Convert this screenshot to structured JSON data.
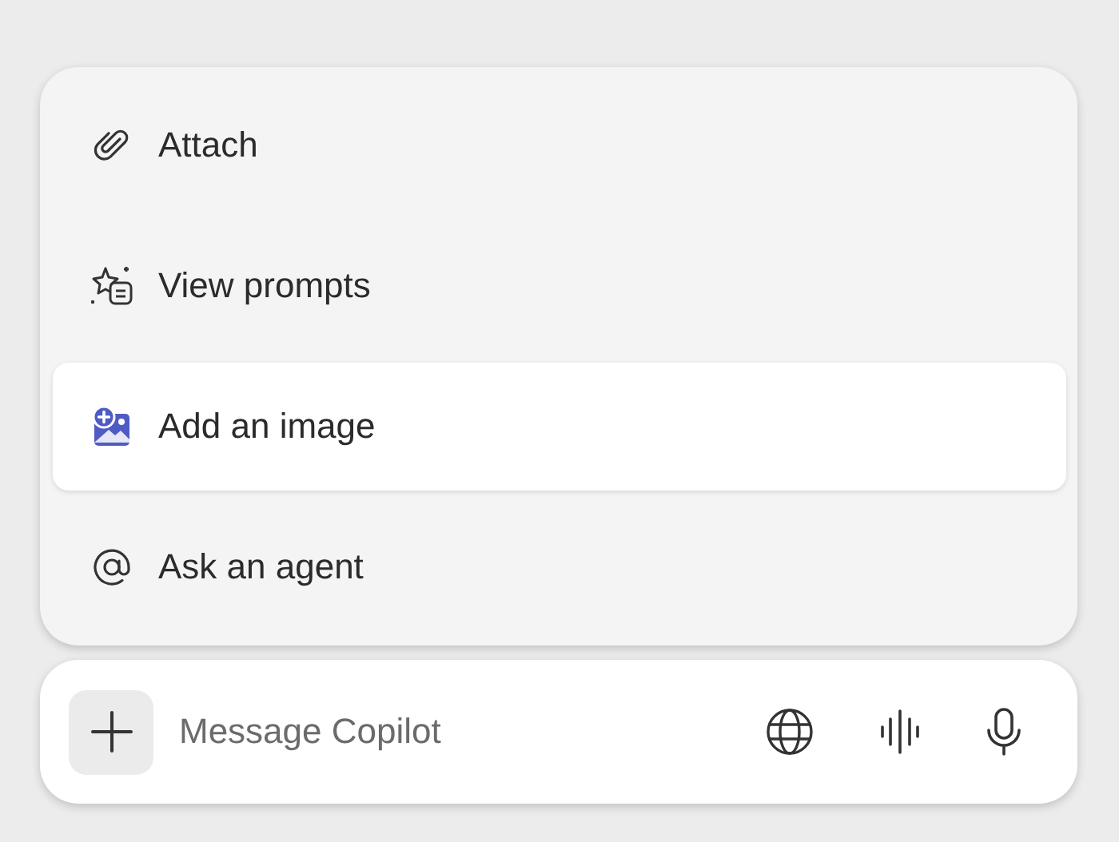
{
  "menu": {
    "items": [
      {
        "kind": "attach",
        "label": "Attach",
        "selected": false
      },
      {
        "kind": "prompts",
        "label": "View prompts",
        "selected": false
      },
      {
        "kind": "image",
        "label": "Add an image",
        "selected": true
      },
      {
        "kind": "agent",
        "label": "Ask an agent",
        "selected": false
      }
    ]
  },
  "composer": {
    "placeholder": "Message Copilot"
  }
}
